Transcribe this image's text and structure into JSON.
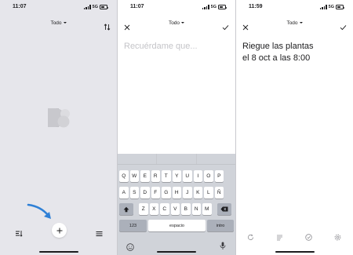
{
  "screen1": {
    "status": {
      "time": "11:07",
      "network": "5G"
    },
    "filter_label": "Todo"
  },
  "screen2": {
    "status": {
      "time": "11:07",
      "network": "5G"
    },
    "filter_label": "Todo",
    "input_placeholder": "Recuérdame que...",
    "keyboard": {
      "row1": [
        "Q",
        "W",
        "E",
        "R",
        "T",
        "Y",
        "U",
        "I",
        "O",
        "P"
      ],
      "row2": [
        "A",
        "S",
        "D",
        "F",
        "G",
        "H",
        "J",
        "K",
        "L",
        "Ñ"
      ],
      "row3": [
        "Z",
        "X",
        "C",
        "V",
        "B",
        "N",
        "M"
      ],
      "numbers_key": "123",
      "space_key": "espacio",
      "return_key": "intro"
    }
  },
  "screen3": {
    "status": {
      "time": "11:59",
      "network": "5G"
    },
    "filter_label": "Todo",
    "reminder_line1": "Riegue las plantas",
    "reminder_line2": "el 8 oct a las 8:00"
  },
  "colors": {
    "arrow": "#2f80d6",
    "empty_bg": "#e6e6eb",
    "keyboard_bg": "#d0d3d9"
  }
}
